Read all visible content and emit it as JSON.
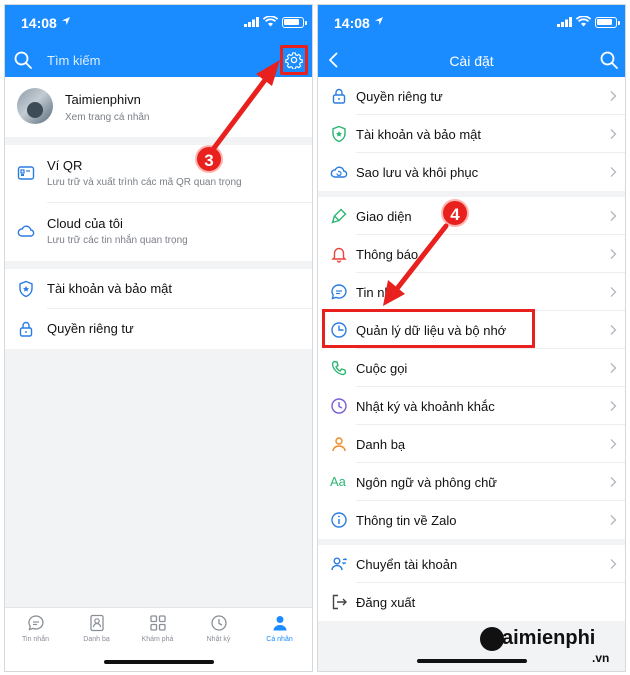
{
  "status": {
    "time": "14:08"
  },
  "left": {
    "search_label": "Tìm kiếm",
    "profile": {
      "name": "Taimienphivn",
      "subtitle": "Xem trang cá nhân"
    },
    "items": [
      {
        "title": "Ví QR",
        "subtitle": "Lưu trữ và xuất trình các mã QR quan trọng",
        "icon": "qr-wallet-icon"
      },
      {
        "title": "Cloud của tôi",
        "subtitle": "Lưu trữ các tin nhắn quan trọng",
        "icon": "cloud-icon"
      }
    ],
    "items2": [
      {
        "title": "Tài khoản và bảo mật",
        "icon": "shield-icon"
      },
      {
        "title": "Quyền riêng tư",
        "icon": "lock-icon"
      }
    ],
    "tabs": [
      {
        "label": "Tin nhắn",
        "icon": "chat-icon"
      },
      {
        "label": "Danh bạ",
        "icon": "contacts-icon"
      },
      {
        "label": "Khám phá",
        "icon": "grid-icon"
      },
      {
        "label": "Nhật ký",
        "icon": "clock-icon"
      },
      {
        "label": "Cá nhân",
        "icon": "person-icon",
        "active": true
      }
    ],
    "step_badge": "3"
  },
  "right": {
    "title": "Cài đặt",
    "group1": [
      {
        "title": "Quyền riêng tư",
        "icon": "lock-icon"
      },
      {
        "title": "Tài khoản và bảo mật",
        "icon": "shield-icon"
      },
      {
        "title": "Sao lưu và khôi phục",
        "icon": "cloud-backup-icon"
      }
    ],
    "group2": [
      {
        "title": "Giao diện",
        "icon": "brush-icon"
      },
      {
        "title": "Thông báo",
        "icon": "bell-icon"
      },
      {
        "title": "Tin nhắn",
        "icon": "message-icon"
      },
      {
        "title": "Quản lý dữ liệu và bộ nhớ",
        "icon": "pie-clock-icon"
      },
      {
        "title": "Cuộc gọi",
        "icon": "phone-icon"
      },
      {
        "title": "Nhật ký và khoảnh khắc",
        "icon": "clock-icon"
      },
      {
        "title": "Danh bạ",
        "icon": "contacts-icon"
      },
      {
        "title": "Ngôn ngữ và phông chữ",
        "icon": "font-icon"
      },
      {
        "title": "Thông tin về Zalo",
        "icon": "info-icon"
      }
    ],
    "group3": [
      {
        "title": "Chuyển tài khoản",
        "icon": "switch-account-icon"
      },
      {
        "title": "Đăng xuất",
        "icon": "logout-icon"
      }
    ],
    "step_badge": "4",
    "partial_message_label": "Tin nh"
  },
  "watermark": {
    "brand": "aimienphi",
    "suffix": ".vn"
  },
  "colors": {
    "brand_blue": "#1a8cff",
    "annotation_red": "#e8211e"
  }
}
